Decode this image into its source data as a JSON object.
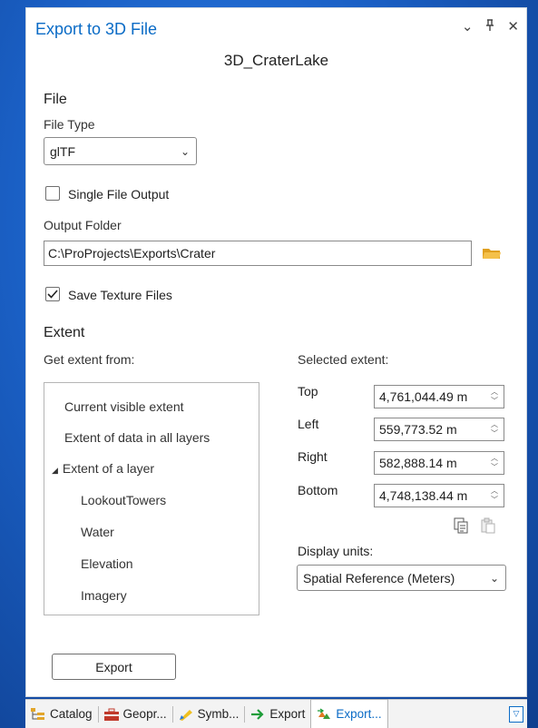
{
  "pane": {
    "title": "Export to 3D File",
    "subtitle": "3D_CraterLake",
    "controls": {
      "collapse": "⌄",
      "pin": "⊥",
      "close": "✕"
    }
  },
  "file": {
    "heading": "File",
    "file_type_label": "File Type",
    "file_type_value": "glTF",
    "single_file_label": "Single File Output",
    "single_file_checked": false,
    "output_folder_label": "Output Folder",
    "output_folder_value": "C:\\ProProjects\\Exports\\Crater",
    "save_texture_label": "Save Texture Files",
    "save_texture_checked": true
  },
  "extent": {
    "heading": "Extent",
    "get_extent_label": "Get extent from:",
    "options": [
      "Current visible extent",
      "Extent of data in all layers",
      "Extent of a layer"
    ],
    "expand_glyph": "◢",
    "layers": [
      "LookoutTowers",
      "Water",
      "Elevation",
      "Imagery"
    ],
    "selected_label": "Selected extent:",
    "fields": [
      {
        "label": "Top",
        "value": "4,761,044.49 m"
      },
      {
        "label": "Left",
        "value": "559,773.52 m"
      },
      {
        "label": "Right",
        "value": "582,888.14 m"
      },
      {
        "label": "Bottom",
        "value": "4,748,138.44 m"
      }
    ],
    "display_units_label": "Display units:",
    "display_units_value": "Spatial Reference (Meters)"
  },
  "export_button": "Export",
  "tabs": [
    {
      "label": "Catalog",
      "icon": "catalog-icon"
    },
    {
      "label": "Geopr...",
      "icon": "toolbox-icon"
    },
    {
      "label": "Symb...",
      "icon": "symbology-icon"
    },
    {
      "label": "Export",
      "icon": "arrow-right-icon"
    },
    {
      "label": "Export...",
      "icon": "export-3d-icon",
      "active": true
    }
  ],
  "colors": {
    "accent": "#0a6bc6",
    "background": "#1a5fc4",
    "folder": "#f2b330"
  }
}
